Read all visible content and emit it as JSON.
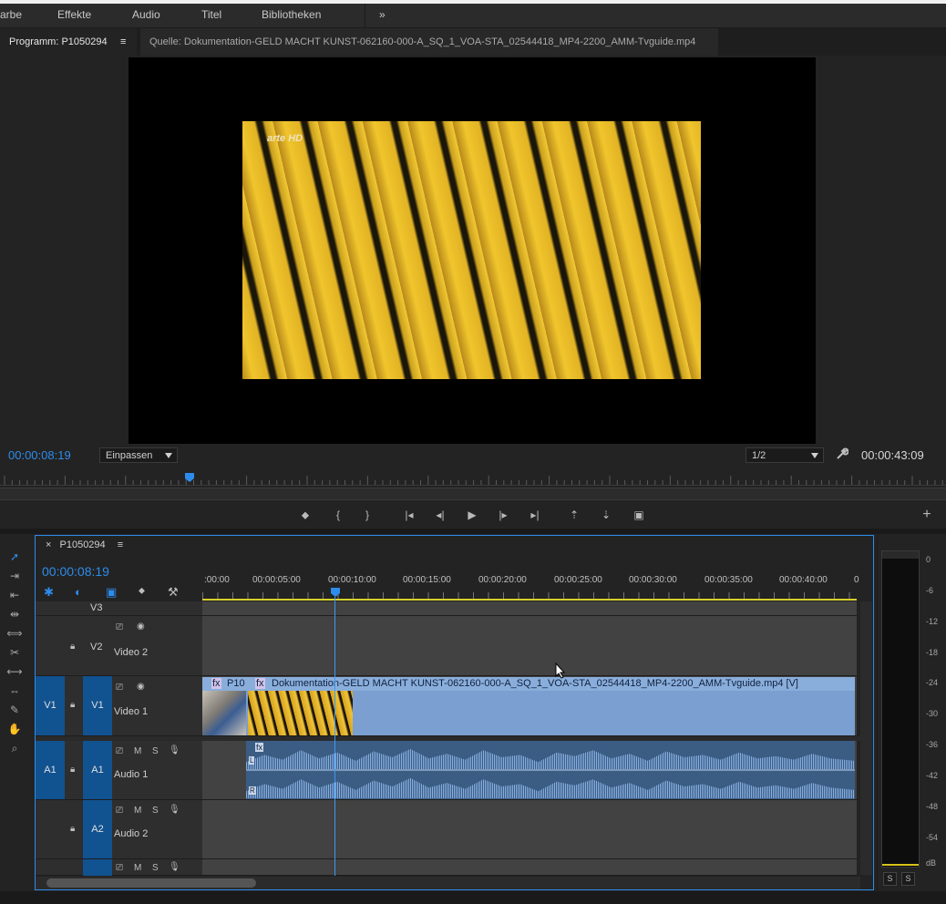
{
  "menu": [
    "arbe",
    "Effekte",
    "Audio",
    "Titel",
    "Bibliotheken",
    "»"
  ],
  "monitor": {
    "active_tab": "Programm: P1050294",
    "tab_menu": "≡",
    "source_tab": "Quelle: Dokumentation-GELD MACHT KUNST-062160-000-A_SQ_1_VOA-STA_02544418_MP4-2200_AMM-Tvguide.mp4",
    "overlay_logo": "arte HD",
    "current_timecode": "00:00:08:19",
    "fit_option": "Einpassen",
    "resolution": "1/2",
    "duration": "00:00:43:09",
    "playhead_fraction": 0.2
  },
  "transport": {
    "marker": "⬥",
    "in_point": "{",
    "out_point": "}",
    "go_to_in": "|◂",
    "step_back": "◂|",
    "play": "▶",
    "step_forward": "|▸",
    "go_to_out": "▸|",
    "lift": "⇡",
    "extract": "⇣",
    "export_frame": "▣",
    "add": "+"
  },
  "timeline": {
    "close": "×",
    "sequence_name": "P1050294",
    "menu": "≡",
    "timecode": "00:00:08:19",
    "ruler_labels": [
      ":00:00",
      "00:00:05:00",
      "00:00:10:00",
      "00:00:15:00",
      "00:00:20:00",
      "00:00:25:00",
      "00:00:30:00",
      "00:00:35:00",
      "00:00:40:00",
      "0"
    ],
    "tracks": {
      "v3": "V3",
      "v2": {
        "target": "V2",
        "name": "Video 2"
      },
      "v1": {
        "source": "V1",
        "target": "V1",
        "name": "Video 1"
      },
      "a1": {
        "source": "A1",
        "target": "A1",
        "name": "Audio 1",
        "mute": "M",
        "solo": "S"
      },
      "a2": {
        "target": "A2",
        "name": "Audio 2",
        "mute": "M",
        "solo": "S"
      },
      "a3": {
        "mute": "M",
        "solo": "S"
      }
    },
    "video_clip": {
      "nested_label": "P10",
      "fx": "fx",
      "title": "Dokumentation-GELD MACHT KUNST-062160-000-A_SQ_1_VOA-STA_02544418_MP4-2200_AMM-Tvguide.mp4 [V]"
    },
    "audio_clip": {
      "fx": "fx",
      "left": "L",
      "right": "R"
    }
  },
  "meter": {
    "db_labels": [
      "0",
      "-6",
      "-12",
      "-18",
      "-24",
      "-30",
      "-36",
      "-42",
      "-48",
      "-54",
      "dB"
    ],
    "solo_left": "S",
    "solo_right": "S"
  },
  "colors": {
    "accent": "#2d8ceb",
    "clip_video": "#7b9fd0",
    "clip_audio": "#3b5d84",
    "nested": "#b391de"
  }
}
